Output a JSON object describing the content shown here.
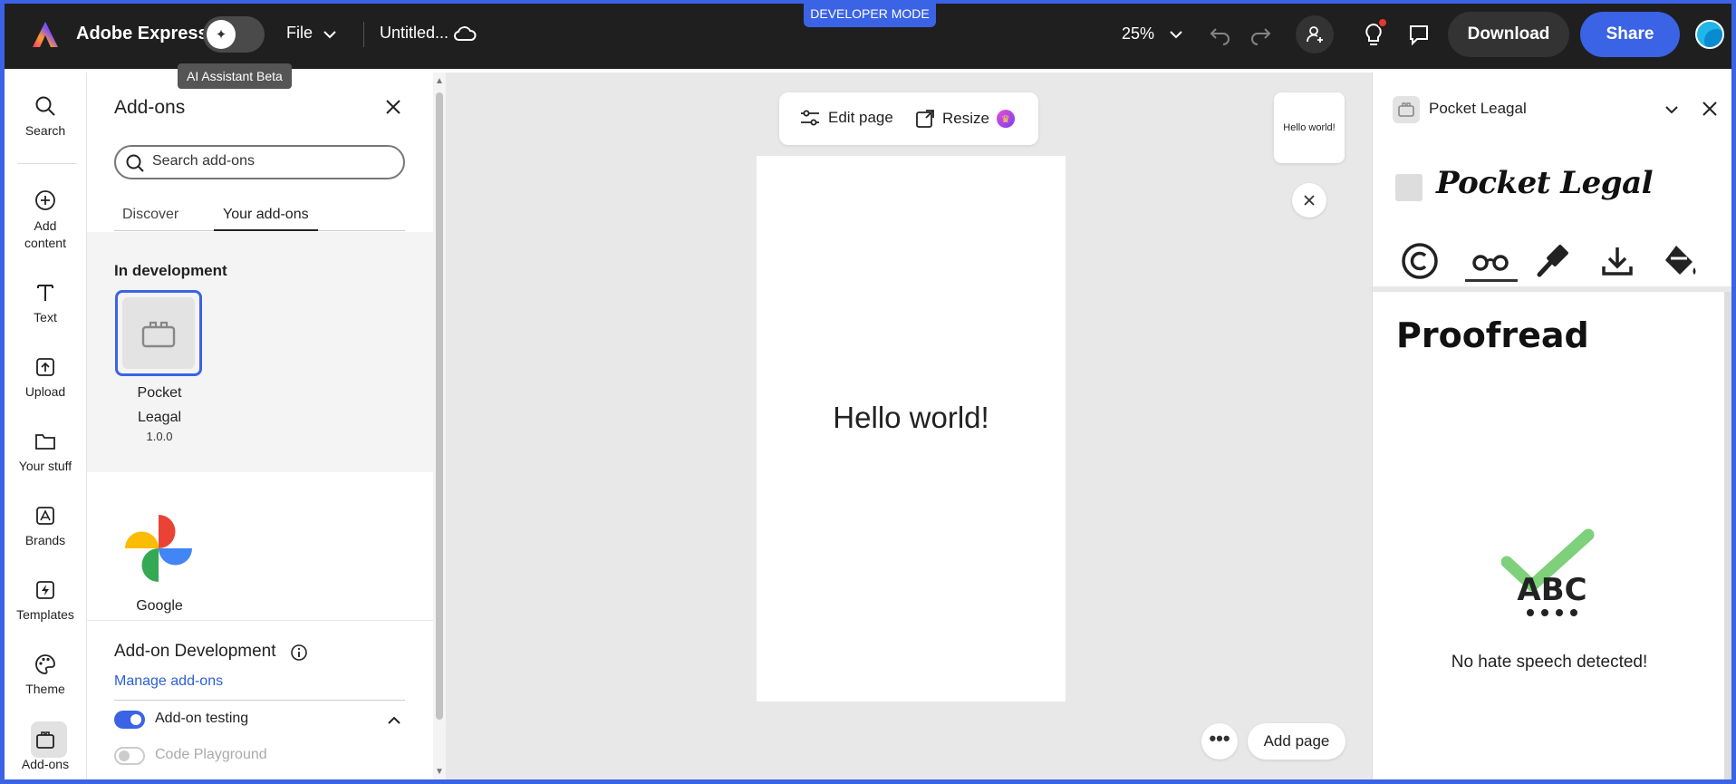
{
  "app": {
    "name": "Adobe Express",
    "ai_tooltip": "AI Assistant Beta",
    "file_menu": "File",
    "doc_title": "Untitled...",
    "dev_badge": "DEVELOPER MODE",
    "zoom": "25%",
    "download_label": "Download",
    "share_label": "Share",
    "accent_color": "#3b63e6"
  },
  "rail": {
    "items": [
      {
        "label": "Search",
        "icon": "search-icon"
      },
      {
        "label": "Add content",
        "icon": "plus-circle-icon"
      },
      {
        "label": "Text",
        "icon": "text-icon"
      },
      {
        "label": "Upload",
        "icon": "upload-icon"
      },
      {
        "label": "Your stuff",
        "icon": "folder-icon"
      },
      {
        "label": "Brands",
        "icon": "brands-icon"
      },
      {
        "label": "Templates",
        "icon": "templates-icon"
      },
      {
        "label": "Theme",
        "icon": "palette-icon"
      },
      {
        "label": "Add-ons",
        "icon": "addons-icon"
      }
    ]
  },
  "addons_panel": {
    "title": "Add-ons",
    "search_placeholder": "Search add-ons",
    "tabs": [
      "Discover",
      "Your add-ons"
    ],
    "in_development_title": "In development",
    "dev_addon": {
      "name": "Pocket Leagal",
      "version": "1.0.0"
    },
    "other_addon": {
      "name": "Google"
    },
    "dev_section_title": "Add-on Development",
    "manage_link": "Manage add-ons",
    "testing_label": "Add-on testing",
    "playground_label": "Code Playground"
  },
  "canvas": {
    "edit_page_label": "Edit page",
    "resize_label": "Resize",
    "page_text": "Hello world!",
    "thumb_text": "Hello world!",
    "more_label": "•••",
    "add_page_label": "Add page"
  },
  "right_panel": {
    "title": "Pocket Leagal",
    "brand": "Pocket Legal",
    "heading": "Proofread",
    "status": "No hate speech detected!"
  }
}
